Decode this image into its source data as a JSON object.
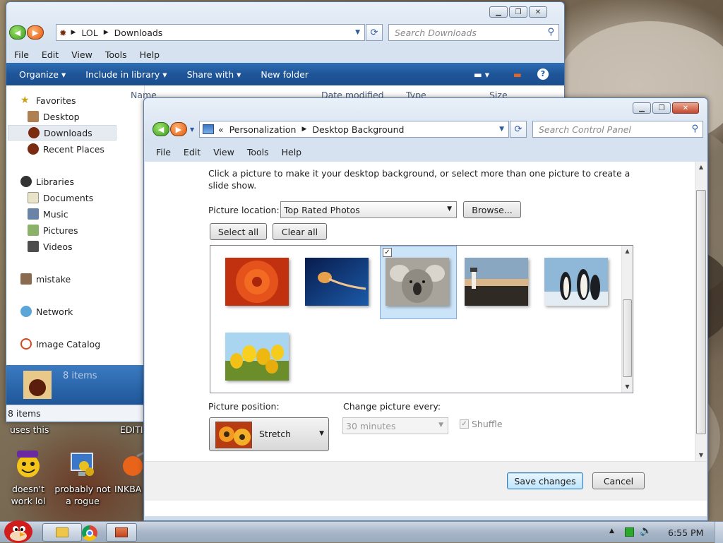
{
  "desktop": {
    "icons": [
      {
        "label": "doesn't work lol"
      },
      {
        "label": "probably not a rogue"
      },
      {
        "label": "INKBA"
      }
    ],
    "fragments": {
      "uses_this": "uses this",
      "editi": "EDITIO"
    }
  },
  "explorer": {
    "breadcrumb": [
      "LOL",
      "Downloads"
    ],
    "search_placeholder": "Search Downloads",
    "menu": [
      "File",
      "Edit",
      "View",
      "Tools",
      "Help"
    ],
    "commands": {
      "organize": "Organize",
      "include": "Include in library",
      "share": "Share with",
      "new_folder": "New folder"
    },
    "columns": [
      "Name",
      "Date modified",
      "Type",
      "Size"
    ],
    "nav": {
      "favorites": "Favorites",
      "fav_items": [
        "Desktop",
        "Downloads",
        "Recent Places"
      ],
      "libraries": "Libraries",
      "lib_items": [
        "Documents",
        "Music",
        "Pictures",
        "Videos"
      ],
      "mistake": "mistake",
      "network": "Network",
      "image_catalog": "Image Catalog"
    },
    "details_count": "8 items",
    "status": "8 items"
  },
  "controlpanel": {
    "breadcrumb": [
      "Personalization",
      "Desktop Background"
    ],
    "search_placeholder": "Search Control Panel",
    "menu": [
      "File",
      "Edit",
      "View",
      "Tools",
      "Help"
    ],
    "instructions": "Click a picture to make it your desktop background, or select more than one picture to create a slide show.",
    "picture_location_label": "Picture location:",
    "picture_location_value": "Top Rated Photos",
    "browse": "Browse...",
    "select_all": "Select all",
    "clear_all": "Clear all",
    "thumbnails": [
      {
        "name": "flower-red-thumbnail",
        "selected": false
      },
      {
        "name": "jellyfish-thumbnail",
        "selected": false
      },
      {
        "name": "koala-thumbnail",
        "selected": true
      },
      {
        "name": "lighthouse-thumbnail",
        "selected": false
      },
      {
        "name": "penguins-thumbnail",
        "selected": false
      },
      {
        "name": "tulips-thumbnail",
        "selected": false
      }
    ],
    "position_label": "Picture position:",
    "position_value": "Stretch",
    "change_label": "Change picture every:",
    "change_value": "30 minutes",
    "shuffle": "Shuffle",
    "save": "Save changes",
    "cancel": "Cancel"
  },
  "taskbar": {
    "clock": "6:55 PM"
  },
  "colors": {
    "accent": "#1f5598",
    "selection": "#cce4f7"
  }
}
